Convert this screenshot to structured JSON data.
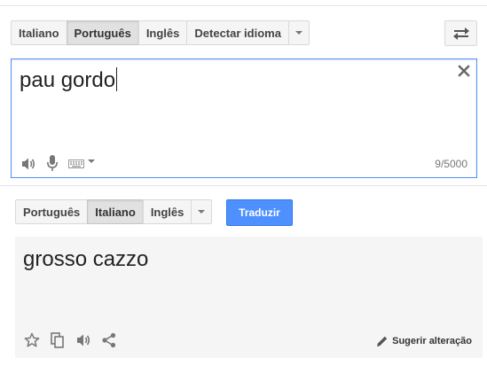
{
  "source_langs": [
    "Italiano",
    "Português",
    "Inglês",
    "Detectar idioma"
  ],
  "target_langs": [
    "Português",
    "Italiano",
    "Inglês"
  ],
  "source": {
    "text": "pau gordo",
    "char_count": "9/5000"
  },
  "translate_label": "Traduzir",
  "result": {
    "text": "grosso cazzo",
    "suggest_label": "Sugerir alteração"
  },
  "icons": [
    "swap-icon",
    "clear-icon",
    "speaker-icon",
    "microphone-icon",
    "keyboard-icon",
    "star-icon",
    "copy-icon",
    "share-icon",
    "pencil-icon"
  ],
  "colors": {
    "accent": "#4d90fe",
    "focus_border": "#4d90fe",
    "result_bg": "#f5f5f5"
  }
}
